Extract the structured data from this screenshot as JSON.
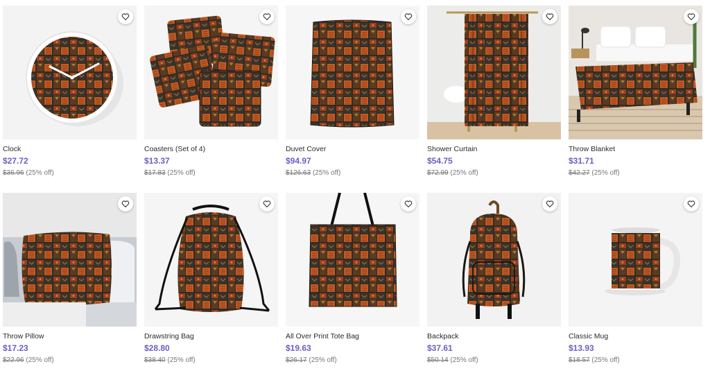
{
  "colors": {
    "price": "#6a5fc1",
    "pattern_dark": "#2f2b24",
    "pattern_rust": "#9a3f1c",
    "pattern_orange": "#c45a22",
    "pattern_tan": "#b07a3a"
  },
  "products": [
    {
      "title": "Clock",
      "price": "$27.72",
      "original_price": "$36.96",
      "discount": "(25% off)",
      "icon": "heart-icon"
    },
    {
      "title": "Coasters (Set of 4)",
      "price": "$13.37",
      "original_price": "$17.83",
      "discount": "(25% off)",
      "icon": "heart-icon"
    },
    {
      "title": "Duvet Cover",
      "price": "$94.97",
      "original_price": "$126.63",
      "discount": "(25% off)",
      "icon": "heart-icon"
    },
    {
      "title": "Shower Curtain",
      "price": "$54.75",
      "original_price": "$72.99",
      "discount": "(25% off)",
      "icon": "heart-icon"
    },
    {
      "title": "Throw Blanket",
      "price": "$31.71",
      "original_price": "$42.27",
      "discount": "(25% off)",
      "icon": "heart-icon"
    },
    {
      "title": "Throw Pillow",
      "price": "$17.23",
      "original_price": "$22.96",
      "discount": "(25% off)",
      "icon": "heart-icon"
    },
    {
      "title": "Drawstring Bag",
      "price": "$28.80",
      "original_price": "$38.40",
      "discount": "(25% off)",
      "icon": "heart-icon"
    },
    {
      "title": "All Over Print Tote Bag",
      "price": "$19.63",
      "original_price": "$26.17",
      "discount": "(25% off)",
      "icon": "heart-icon"
    },
    {
      "title": "Backpack",
      "price": "$37.61",
      "original_price": "$50.14",
      "discount": "(25% off)",
      "icon": "heart-icon"
    },
    {
      "title": "Classic Mug",
      "price": "$13.93",
      "original_price": "$18.57",
      "discount": "(25% off)",
      "icon": "heart-icon"
    }
  ]
}
